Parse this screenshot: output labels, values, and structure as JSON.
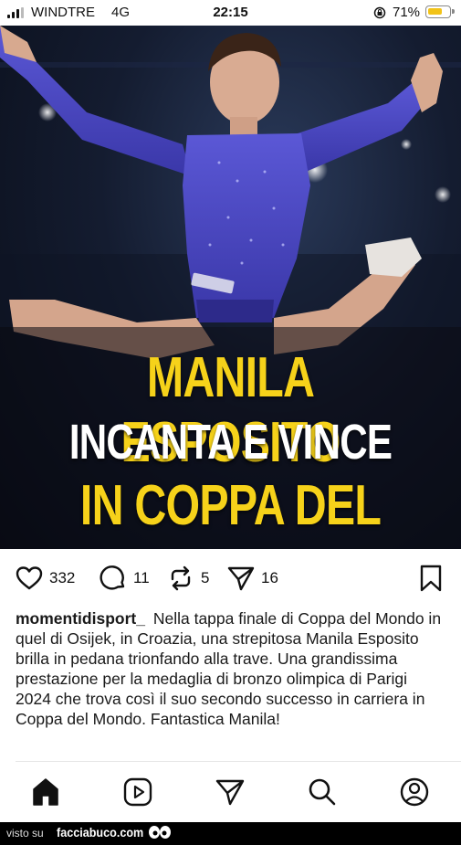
{
  "status_bar": {
    "carrier": "WINDTRE",
    "network": "4G",
    "time": "22:15",
    "battery_percent": "71%",
    "battery_level": 0.71,
    "battery_color": "#f2c318"
  },
  "post": {
    "headline": {
      "line1": "MANILA ESPOSITO",
      "line2": "INCANTA E VINCE",
      "line3": "IN COPPA DEL MONDO",
      "accent_color": "#f6d21a"
    },
    "actions": {
      "likes": "332",
      "comments": "11",
      "reposts": "5",
      "shares": "16"
    },
    "caption": {
      "username": "momentidisport_",
      "text": "Nella tappa finale di Coppa del Mondo in quel di Osijek, in Croazia, una strepitosa Manila Esposito brilla in pedana trionfando alla trave. Una grandissima prestazione per la medaglia di bronzo olimpica di Parigi 2024 che trova così il suo secondo successo in carriera in Coppa del Mondo. Fantastica Manila!"
    }
  },
  "nav": {
    "items": [
      "home-icon",
      "reels-icon",
      "send-icon",
      "search-icon",
      "profile-icon"
    ]
  },
  "watermark": {
    "prefix": "visto su",
    "site": "facciabuco.com"
  }
}
